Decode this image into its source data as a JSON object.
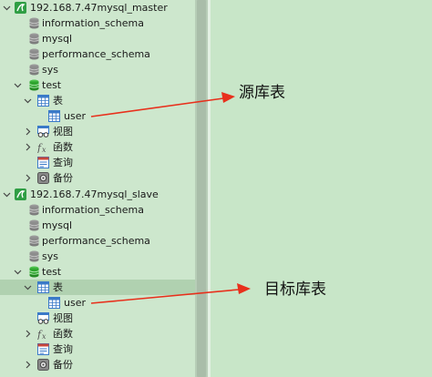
{
  "tree": {
    "master": {
      "connection": "192.168.7.47mysql_master",
      "databases": [
        "information_schema",
        "mysql",
        "performance_schema",
        "sys"
      ],
      "test_db": "test",
      "tables_folder": "表",
      "table": "user",
      "views": "视图",
      "functions": "函数",
      "queries": "查询",
      "backups": "备份"
    },
    "slave": {
      "connection": "192.168.7.47mysql_slave",
      "databases": [
        "information_schema",
        "mysql",
        "performance_schema",
        "sys"
      ],
      "test_db": "test",
      "tables_folder": "表",
      "table": "user",
      "views": "视图",
      "functions": "函数",
      "queries": "查询",
      "backups": "备份"
    }
  },
  "annotations": {
    "source": "源库表",
    "target": "目标库表",
    "arrow_color": "#e8301c"
  }
}
